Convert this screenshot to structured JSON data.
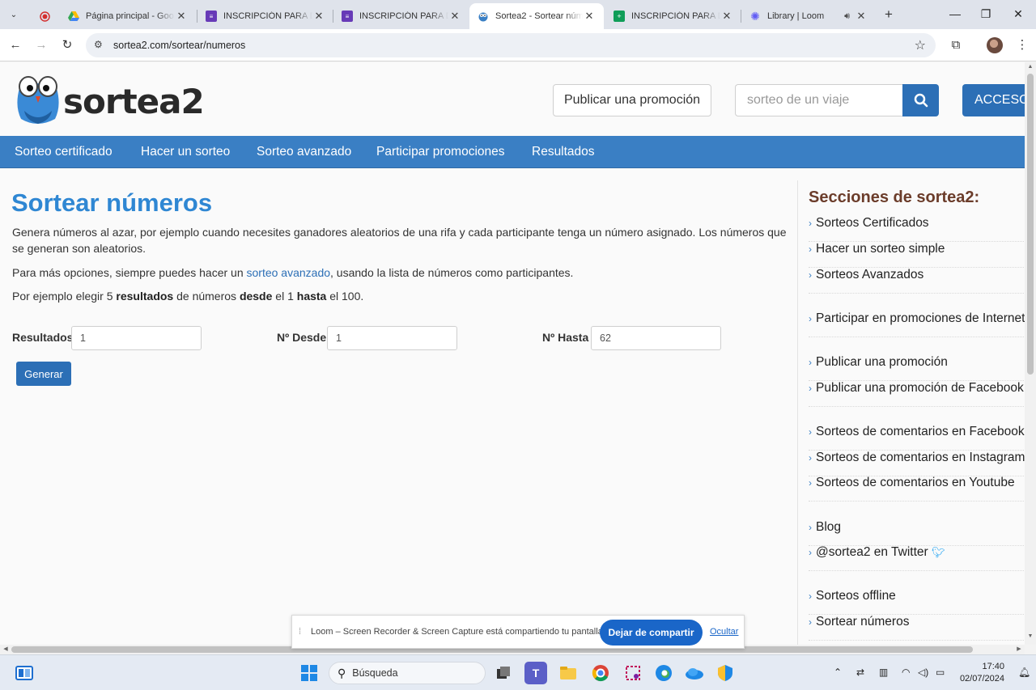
{
  "browser": {
    "tabs": [
      {
        "title": "Página principal - Goo",
        "active": false
      },
      {
        "title": "INSCRIPCIÓN PARA DI",
        "active": false
      },
      {
        "title": "INSCRIPCIÓN PARA DI",
        "active": false
      },
      {
        "title": "Sortea2 - Sortear núm",
        "active": true
      },
      {
        "title": "INSCRIPCIÓN PARA DI",
        "active": false
      },
      {
        "title": "Library | Loom",
        "active": false
      }
    ],
    "url": "sortea2.com/sortear/numeros"
  },
  "header": {
    "logo_text": "sortea2",
    "publish_button": "Publicar una promoción",
    "search_placeholder": "sorteo de un viaje",
    "access_button": "ACCESO"
  },
  "nav": {
    "items": [
      "Sorteo certificado",
      "Hacer un sorteo",
      "Sorteo avanzado",
      "Participar promociones",
      "Resultados"
    ]
  },
  "main": {
    "title": "Sortear números",
    "intro": "Genera números al azar, por ejemplo cuando necesites ganadores aleatorios de una rifa y cada participante tenga un número asignado. Los números que se generan son aleatorios.",
    "more_prefix": "Para más opciones, siempre puedes hacer un ",
    "more_link": "sorteo avanzado",
    "more_suffix": ", usando la lista de números como participantes.",
    "example": {
      "t1": "Por ejemplo elegir 5 ",
      "b1": "resultados",
      "t2": " de números ",
      "b2": "desde",
      "t3": " el 1 ",
      "b3": "hasta",
      "t4": " el 100."
    },
    "form": {
      "results_label": "Resultados",
      "results_value": "1",
      "from_label": "Nº Desde",
      "from_value": "1",
      "to_label": "Nº Hasta",
      "to_value": "62",
      "generate_button": "Generar"
    }
  },
  "sidebar": {
    "title": "Secciones de sortea2:",
    "items": [
      "Sorteos Certificados",
      "Hacer un sorteo simple",
      "Sorteos Avanzados",
      "Participar en promociones de Internet",
      "Publicar una promoción",
      "Publicar una promoción de Facebook",
      "Sorteos de comentarios en Facebook",
      "Sorteos de comentarios en Instagram",
      "Sorteos de comentarios en Youtube",
      "Blog",
      "@sortea2 en Twitter",
      "Sorteos offline",
      "Sortear números"
    ]
  },
  "loom_banner": {
    "message": "Loom – Screen Recorder & Screen Capture está compartiendo tu pantalla.",
    "stop_button": "Dejar de compartir",
    "hide_link": "Ocultar"
  },
  "taskbar": {
    "search_placeholder": "Búsqueda",
    "time": "17:40",
    "date": "02/07/2024"
  },
  "colors": {
    "nav_blue": "#3a7fc4",
    "title_blue": "#2f87d3",
    "button_blue": "#2c6fb6",
    "sidebar_title": "#6b3c2a"
  }
}
